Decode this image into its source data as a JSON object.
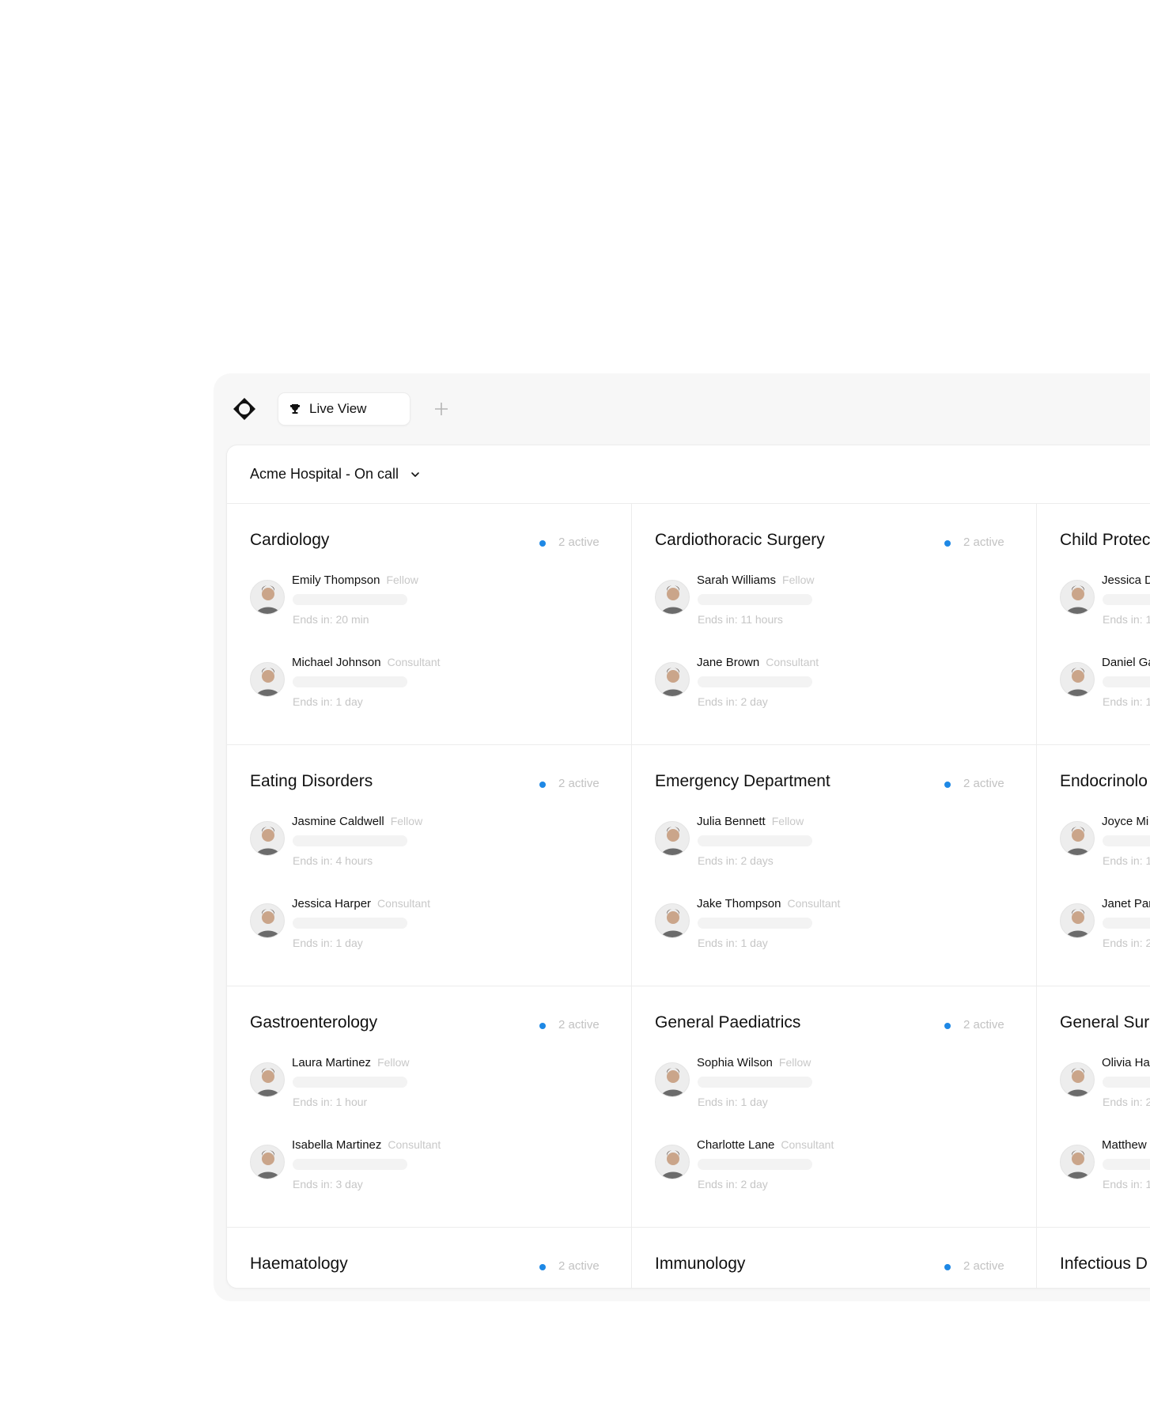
{
  "tabs": [
    {
      "label": "Live View",
      "icon": "trophy-icon"
    }
  ],
  "header": {
    "title": "Acme Hospital - On call",
    "icon": "chevron-down-icon"
  },
  "colors": {
    "active_dot": "#1e88e5"
  },
  "departments": [
    {
      "name": "Cardiology",
      "active": "2 active",
      "staff": [
        {
          "name": "Emily Thompson",
          "role": "Fellow",
          "ends": "Ends in: 20 min"
        },
        {
          "name": "Michael Johnson",
          "role": "Consultant",
          "ends": "Ends in: 1 day"
        }
      ]
    },
    {
      "name": "Cardiothoracic Surgery",
      "active": "2 active",
      "staff": [
        {
          "name": "Sarah Williams",
          "role": "Fellow",
          "ends": "Ends in: 11 hours"
        },
        {
          "name": "Jane Brown",
          "role": "Consultant",
          "ends": "Ends in: 2 day"
        }
      ]
    },
    {
      "name": "Child Protec",
      "active": "",
      "staff": [
        {
          "name": "Jessica D",
          "role": "",
          "ends": "Ends in: 1"
        },
        {
          "name": "Daniel Ga",
          "role": "",
          "ends": "Ends in: 1"
        }
      ]
    },
    {
      "name": "Eating Disorders",
      "active": "2 active",
      "staff": [
        {
          "name": "Jasmine Caldwell",
          "role": "Fellow",
          "ends": "Ends in: 4 hours"
        },
        {
          "name": "Jessica Harper",
          "role": "Consultant",
          "ends": "Ends in: 1 day"
        }
      ]
    },
    {
      "name": "Emergency Department",
      "active": "2 active",
      "staff": [
        {
          "name": "Julia Bennett",
          "role": "Fellow",
          "ends": "Ends in: 2 days"
        },
        {
          "name": "Jake Thompson",
          "role": "Consultant",
          "ends": "Ends in: 1 day"
        }
      ]
    },
    {
      "name": "Endocrinolo",
      "active": "",
      "staff": [
        {
          "name": "Joyce Mi",
          "role": "",
          "ends": "Ends in: 1"
        },
        {
          "name": "Janet Par",
          "role": "",
          "ends": "Ends in: 2"
        }
      ]
    },
    {
      "name": "Gastroenterology",
      "active": "2 active",
      "staff": [
        {
          "name": "Laura Martinez",
          "role": "Fellow",
          "ends": "Ends in: 1 hour"
        },
        {
          "name": "Isabella Martinez",
          "role": "Consultant",
          "ends": "Ends in: 3 day"
        }
      ]
    },
    {
      "name": "General Paediatrics",
      "active": "2 active",
      "staff": [
        {
          "name": "Sophia Wilson",
          "role": "Fellow",
          "ends": "Ends in: 1 day"
        },
        {
          "name": "Charlotte Lane",
          "role": "Consultant",
          "ends": "Ends in: 2 day"
        }
      ]
    },
    {
      "name": "General Surg",
      "active": "",
      "staff": [
        {
          "name": "Olivia Har",
          "role": "",
          "ends": "Ends in: 2"
        },
        {
          "name": "Matthew",
          "role": "",
          "ends": "Ends in: 1"
        }
      ]
    },
    {
      "name": "Haematology",
      "active": "2 active",
      "staff": []
    },
    {
      "name": "Immunology",
      "active": "2 active",
      "staff": []
    },
    {
      "name": "Infectious D",
      "active": "",
      "staff": []
    }
  ]
}
